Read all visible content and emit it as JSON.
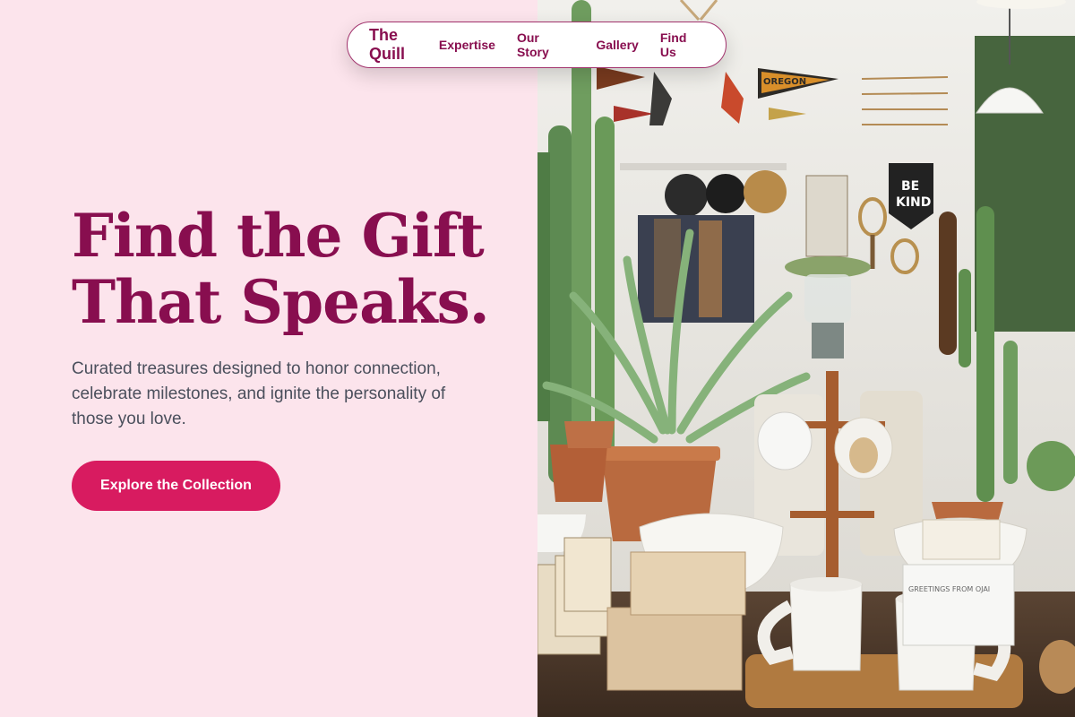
{
  "nav": {
    "brand": "The Quill",
    "links": [
      "Expertise",
      "Our Story",
      "Gallery",
      "Find Us"
    ]
  },
  "hero": {
    "title_line1": "Find the Gift",
    "title_line2": "That Speaks.",
    "subtitle": "Curated treasures designed to honor connection, celebrate milestones, and ignite the personality of those you love.",
    "cta_label": "Explore the Collection"
  },
  "photo": {
    "pennant_text": "OREGON",
    "banner_line1": "BE",
    "banner_line2": "KIND",
    "card_text": "GREETINGS FROM OJAI"
  },
  "colors": {
    "background": "#fce4ec",
    "primary": "#880e4f",
    "accent": "#d81b60",
    "body_text": "#4a4f5c"
  }
}
